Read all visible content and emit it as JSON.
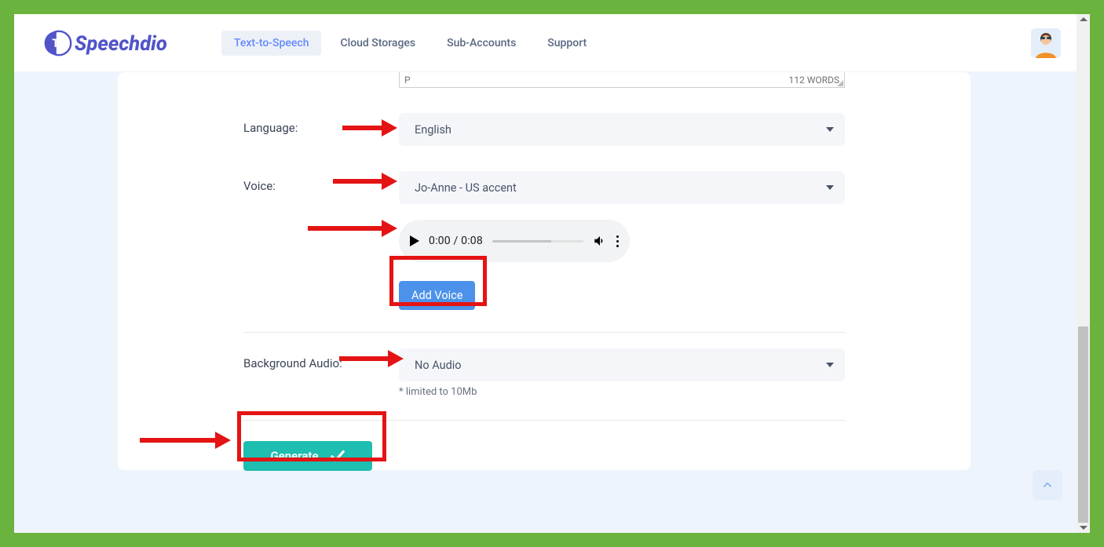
{
  "brand": {
    "name": "Speechdio",
    "accent": "#5154c8"
  },
  "nav": {
    "items": [
      {
        "label": "Text-to-Speech",
        "active": true
      },
      {
        "label": "Cloud Storages",
        "active": false
      },
      {
        "label": "Sub-Accounts",
        "active": false
      },
      {
        "label": "Support",
        "active": false
      }
    ]
  },
  "editor": {
    "word_count_label": "112 WORDS",
    "status_char": "P"
  },
  "form": {
    "language": {
      "label": "Language:",
      "value": "English"
    },
    "voice": {
      "label": "Voice:",
      "value": "Jo-Anne - US accent"
    },
    "bgaudio": {
      "label": "Background Audio:",
      "value": "No Audio",
      "hint": "* limited to 10Mb"
    }
  },
  "audio": {
    "current": "0:00",
    "total": "0:08"
  },
  "buttons": {
    "add_voice": "Add Voice",
    "generate": "Generate"
  },
  "colors": {
    "page_bg": "#6ab33e",
    "desk_bg": "#eef4fc",
    "primary_blue": "#4d92ea",
    "generate_teal": "#1ebeb0",
    "annotation_red": "#e41414"
  }
}
